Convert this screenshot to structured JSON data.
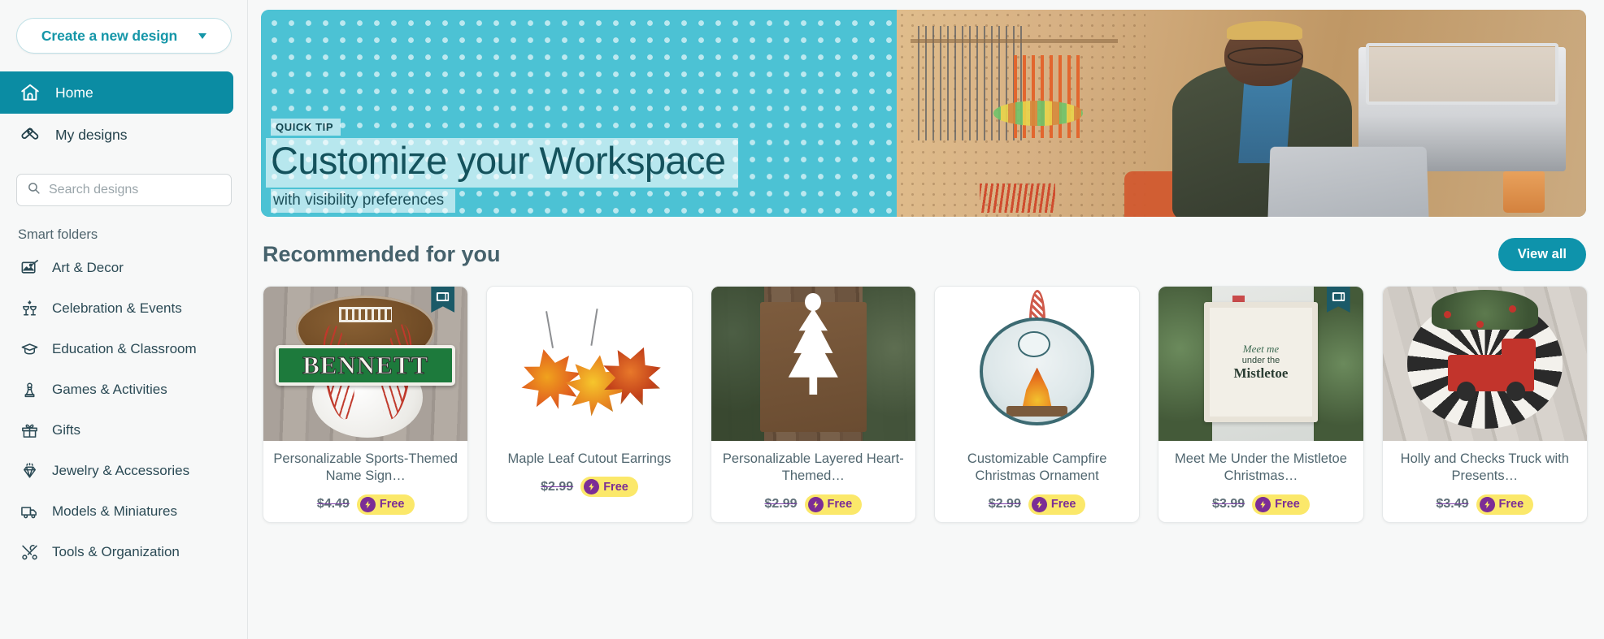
{
  "sidebar": {
    "create_button": {
      "label": "Create a new design",
      "icon": "chevron-down-icon"
    },
    "nav": [
      {
        "label": "Home",
        "icon": "home-icon",
        "active": true
      },
      {
        "label": "My designs",
        "icon": "design-tools-icon",
        "active": false
      }
    ],
    "search": {
      "placeholder": "Search designs",
      "value": "",
      "icon": "search-icon"
    },
    "smart_folders_title": "Smart folders",
    "folders": [
      {
        "label": "Art & Decor",
        "icon": "art-image-icon"
      },
      {
        "label": "Celebration & Events",
        "icon": "cheers-glasses-icon"
      },
      {
        "label": "Education & Classroom",
        "icon": "graduation-cap-icon"
      },
      {
        "label": "Games & Activities",
        "icon": "chess-pawn-icon"
      },
      {
        "label": "Gifts",
        "icon": "gift-box-icon"
      },
      {
        "label": "Jewelry & Accessories",
        "icon": "gem-icon"
      },
      {
        "label": "Models & Miniatures",
        "icon": "truck-icon"
      },
      {
        "label": "Tools & Organization",
        "icon": "tools-icon"
      }
    ]
  },
  "banner": {
    "eyebrow": "QUICK TIP",
    "headline": "Customize your Workspace",
    "subhead": "with visibility preferences",
    "bg_color": "#4cc2d4"
  },
  "recommended": {
    "title": "Recommended for you",
    "view_all_label": "View all",
    "free_label": "Free",
    "cards": [
      {
        "title": "Personalizable Sports-Themed Name Sign…",
        "price": "$4.49",
        "free": "Free",
        "badge": "project-card-icon",
        "has_badge": true,
        "name_text": "BENNETT"
      },
      {
        "title": "Maple Leaf Cutout Earrings",
        "price": "$2.99",
        "free": "Free",
        "badge": "",
        "has_badge": false
      },
      {
        "title": "Personalizable Layered Heart-Themed…",
        "price": "$2.99",
        "free": "Free",
        "badge": "",
        "has_badge": false
      },
      {
        "title": "Customizable Campfire Christmas Ornament",
        "price": "$2.99",
        "free": "Free",
        "badge": "",
        "has_badge": false
      },
      {
        "title": "Meet Me Under the Mistletoe Christmas…",
        "price": "$3.99",
        "free": "Free",
        "badge": "project-card-icon",
        "has_badge": true,
        "frame_line1": "Meet me",
        "frame_line2": "under the",
        "frame_line3": "Mistletoe"
      },
      {
        "title": "Holly and Checks Truck with Presents…",
        "price": "$3.49",
        "free": "Free",
        "badge": "",
        "has_badge": false
      }
    ]
  },
  "colors": {
    "accent_teal": "#0e93ab",
    "active_nav": "#0b8ca3",
    "banner_cyan": "#4cc2d4",
    "free_badge_yellow": "#fbe86a",
    "free_badge_purple": "#7b2d96",
    "text_slate": "#50666f"
  }
}
